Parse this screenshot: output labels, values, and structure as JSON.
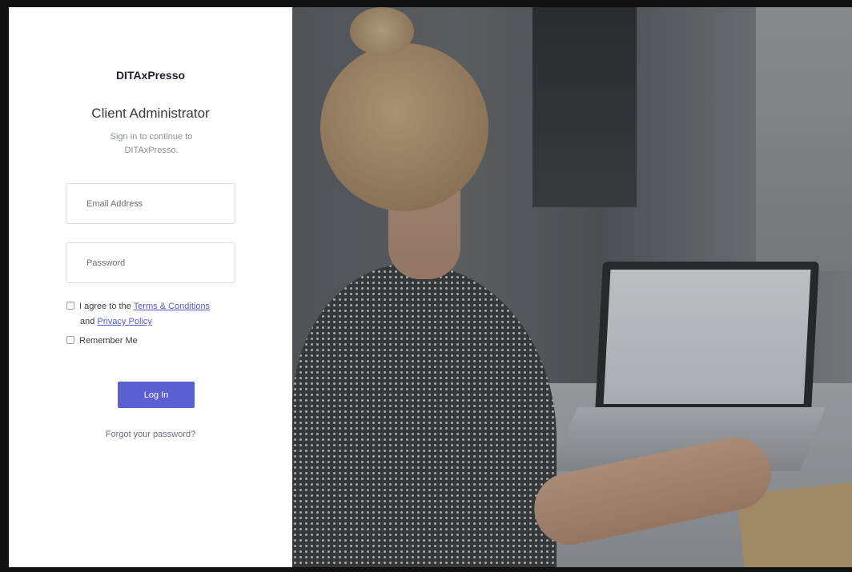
{
  "brand": {
    "name": "DITAxPresso"
  },
  "login": {
    "heading": "Client Administrator",
    "subtext": "Sign in to continue to DITAxPresso.",
    "email_placeholder": "Email Address",
    "password_placeholder": "Password",
    "terms": {
      "prefix": "I agree to the",
      "terms_link": "Terms & Conditions",
      "middle": "and",
      "privacy_link": "Privacy Policy"
    },
    "remember_label": "Remember Me",
    "login_button": "Log In",
    "forgot_link": "Forgot your password?"
  },
  "colors": {
    "accent": "#5a60d1",
    "link": "#5559c9",
    "frame": "#111111"
  }
}
